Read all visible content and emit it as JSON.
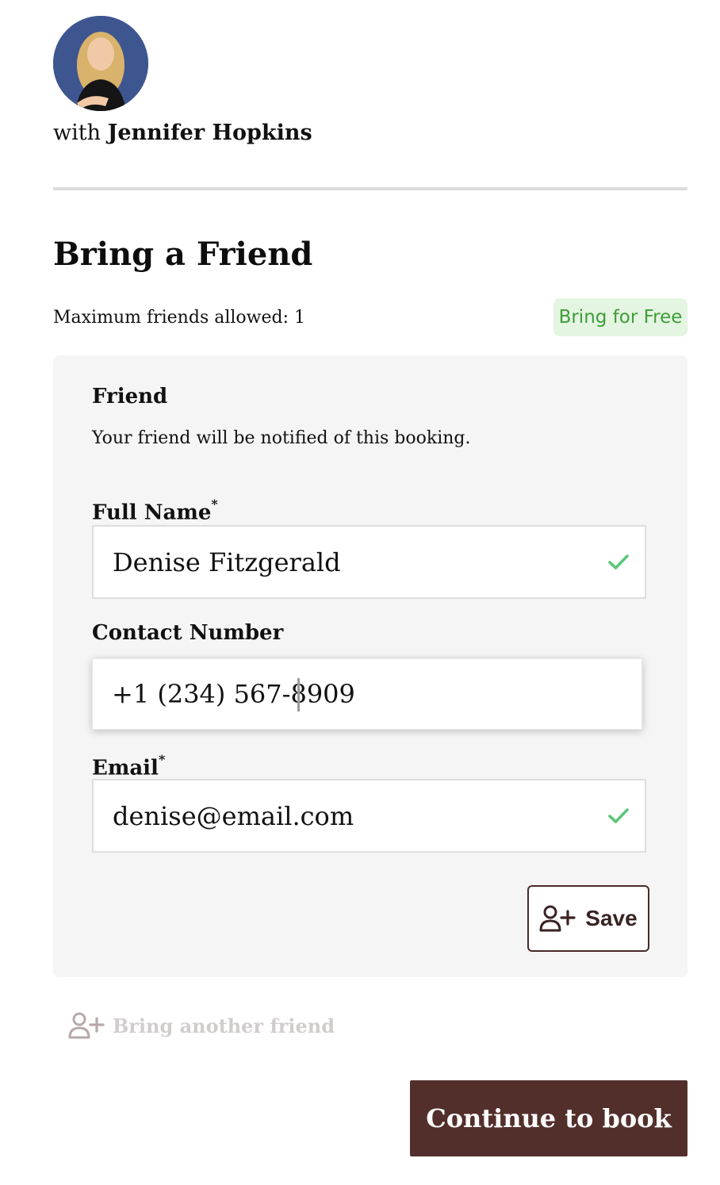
{
  "host": {
    "prefix": "with",
    "name": "Jennifer Hopkins",
    "avatar_icon": "profile-photo"
  },
  "section": {
    "title": "Bring a Friend",
    "max_friends_text": "Maximum friends allowed: 1",
    "badge": "Bring for Free"
  },
  "friend_card": {
    "title": "Friend",
    "description": "Your friend will be notified of this booking.",
    "full_name": {
      "label": "Full Name",
      "required_mark": "*",
      "value": "Denise Fitzgerald",
      "valid_icon": "check-icon"
    },
    "contact_number": {
      "label": "Contact Number",
      "value": "+1 (234) 567-8909"
    },
    "email": {
      "label": "Email",
      "required_mark": "*",
      "value": "denise@email.com",
      "valid_icon": "check-icon"
    },
    "save_label": "Save",
    "save_icon": "add-user-icon"
  },
  "another_friend": {
    "label": "Bring another friend",
    "icon": "add-user-icon"
  },
  "continue_label": "Continue to book",
  "colors": {
    "brand_dark": "#532f2c",
    "success_green": "#3f9d3a",
    "badge_bg": "#e4f5e1",
    "check_green": "#5dc67a",
    "card_bg": "#f5f5f5"
  }
}
